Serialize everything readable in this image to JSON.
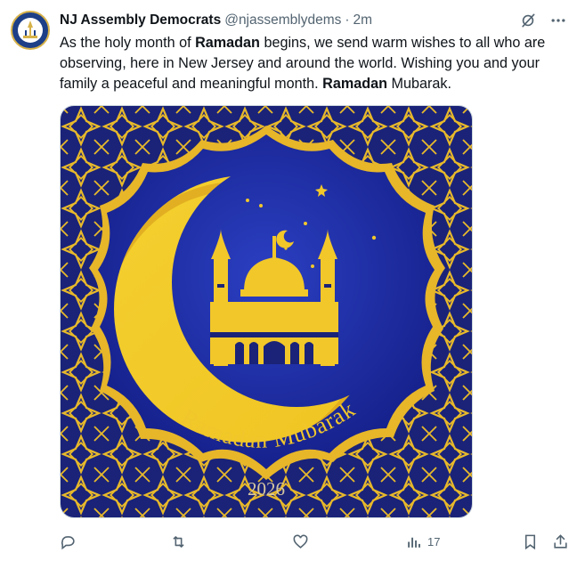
{
  "author": {
    "name": "NJ Assembly Democrats",
    "handle": "@njassemblydems",
    "separator": "·",
    "time": "2m"
  },
  "tweet": {
    "text_parts": [
      "As the holy month of ",
      "Ramadan",
      " begins, we send warm wishes to all who are observing, here in New Jersey and around the world. Wishing you and your family a peaceful and meaningful month. ",
      "Ramadan",
      " Mubarak."
    ]
  },
  "media": {
    "headline": "Ramadan Mubarak",
    "year": "2026",
    "colors": {
      "background": "#1b2a8f",
      "gold": "#f0c62c",
      "gold_dark": "#d9a21c",
      "frame": "#1a2378"
    }
  },
  "actions": {
    "reply_icon": "reply-icon",
    "retweet_icon": "retweet-icon",
    "like_icon": "heart-icon",
    "views_icon": "analytics-icon",
    "views_count": "17",
    "bookmark_icon": "bookmark-icon",
    "share_icon": "share-icon"
  },
  "colors": {
    "text": "#0f1419",
    "muted": "#536471",
    "border": "#cfd9de"
  }
}
